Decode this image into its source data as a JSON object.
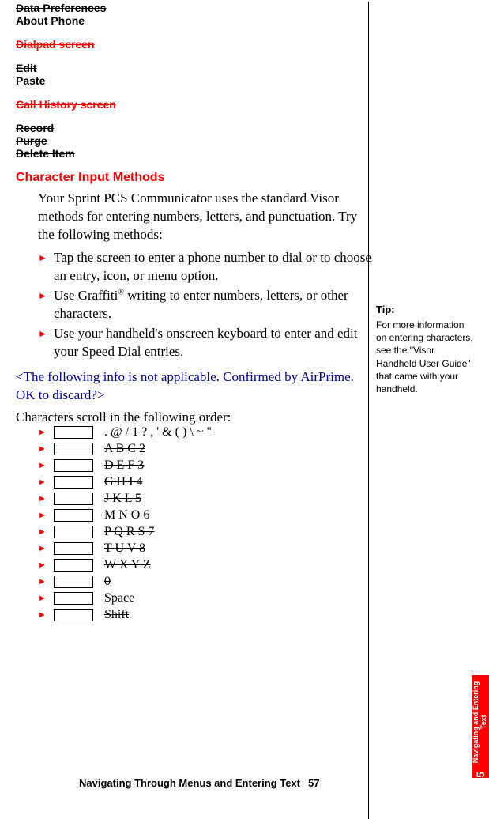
{
  "menu": {
    "data_prefs": "Data Preferences",
    "about_phone": "About Phone",
    "dialpad": "Dialpad screen",
    "edit": "Edit",
    "paste": "Paste",
    "call_history": "Call History screen",
    "record": "Record",
    "purge": "Purge",
    "delete_item": "Delete Item"
  },
  "section": {
    "title": "Character Input Methods",
    "intro": "Your Sprint PCS Communicator uses the standard Visor methods for entering numbers, letters, and punctuation. Try the following methods:",
    "bullets": [
      "Tap the screen to enter a phone number to dial or to choose an entry, icon, or menu option.",
      "Use Graffiti® writing to enter numbers, letters, or other characters.",
      "Use your handheld's onscreen keyboard to enter and edit your Speed Dial entries."
    ],
    "blue_note": "<The following info is not applicable. Confirmed by AirPrime. OK to discard?>",
    "scroll_intro": "Characters scroll in the following order:",
    "rows": [
      ". @ / 1 ? , ' &   ( ) \\  ~ \"",
      "A B C 2",
      "D E F 3",
      "G H I 4",
      "J K L 5",
      "M N O 6",
      "P Q R S 7",
      "T U V 8",
      "W X Y Z",
      "0",
      "Space",
      "Shift"
    ]
  },
  "tip": {
    "head": "Tip:",
    "body": "For more information on entering characters, see the \"Visor Handheld User Guide\" that came with your handheld."
  },
  "footer": {
    "title": "Navigating Through Menus and Entering Text",
    "page": "57"
  },
  "tab": {
    "text": "Navigating and Entering Text",
    "num": "5"
  }
}
